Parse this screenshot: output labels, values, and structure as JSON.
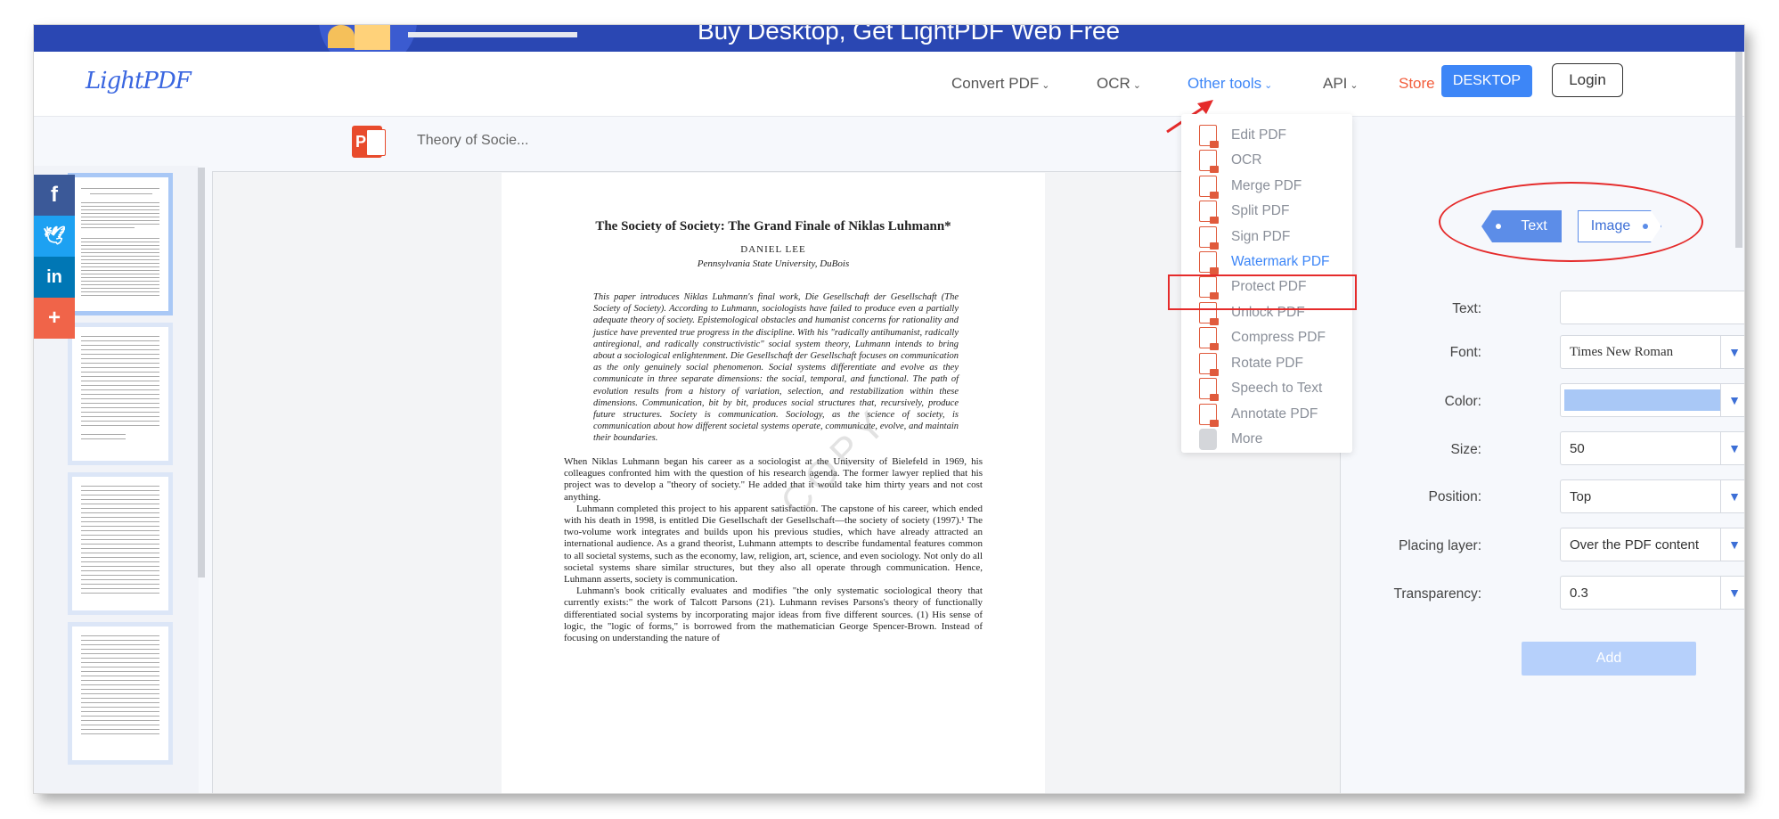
{
  "banner": {
    "text": "Buy Desktop, Get LightPDF Web Free"
  },
  "header": {
    "logo": "LightPDF",
    "nav": [
      "Convert PDF",
      "OCR",
      "Other tools",
      "API",
      "Store"
    ],
    "desktop_button": "DESKTOP",
    "login_button": "Login"
  },
  "file": {
    "icon_letter": "P",
    "name": "Theory of Socie..."
  },
  "social": [
    "facebook-icon",
    "twitter-icon",
    "linkedin-icon",
    "share-plus-icon"
  ],
  "dropdown": {
    "items": [
      "Edit PDF",
      "OCR",
      "Merge PDF",
      "Split PDF",
      "Sign PDF",
      "Watermark PDF",
      "Protect PDF",
      "Unlock PDF",
      "Compress PDF",
      "Rotate PDF",
      "Speech to Text",
      "Annotate PDF",
      "More"
    ],
    "highlighted": "Watermark PDF"
  },
  "document": {
    "title": "The Society of Society: The Grand Finale of Niklas Luhmann*",
    "author": "DANIEL LEE",
    "affiliation": "Pennsylvania State University, DuBois",
    "abstract": "This paper introduces Niklas Luhmann's final work, Die Gesellschaft der Gesellschaft (The Society of Society). According to Luhmann, sociologists have failed to produce even a partially adequate theory of society. Epistemological obstacles and humanist concerns for rationality and justice have prevented true progress in the discipline. With his \"radically antihumanist, radically antiregional, and radically constructivistic\" social system theory, Luhmann intends to bring about a sociological enlightenment. Die Gesellschaft der Gesellschaft focuses on communication as the only genuinely social phenomenon. Social systems differentiate and evolve as they communicate in three separate dimensions: the social, temporal, and functional. The path of evolution results from a history of variation, selection, and restabilization within these dimensions. Communication, bit by bit, produces social structures that, recursively, produce future structures. Society is communication. Sociology, as the science of society, is communication about how different societal systems operate, communicate, evolve, and maintain their boundaries.",
    "paragraphs": [
      "When Niklas Luhmann began his career as a sociologist at the University of Bielefeld in 1969, his colleagues confronted him with the question of his research agenda. The former lawyer replied that his project was to develop a \"theory of society.\" He added that it would take him thirty years and not cost anything.",
      "Luhmann completed this project to his apparent satisfaction. The capstone of his career, which ended with his death in 1998, is entitled Die Gesellschaft der Gesellschaft—the society of society (1997).¹ The two-volume work integrates and builds upon his previous studies, which have already attracted an international audience. As a grand theorist, Luhmann attempts to describe fundamental features common to all societal systems, such as the economy, law, religion, art, science, and even sociology. Not only do all societal systems share similar structures, but they also all operate through communication. Hence, Luhmann asserts, society is communication.",
      "Luhmann's book critically evaluates and modifies \"the only systematic sociological theory that currently exists:\" the work of Talcott Parsons (21). Luhmann revises Parsons's theory of functionally differentiated social systems by incorporating major ideas from five different sources. (1) His sense of logic, the \"logic of forms,\" is borrowed from the mathematician George Spencer-Brown. Instead of focusing on understanding the nature of"
    ],
    "watermark_text": "COPY"
  },
  "panel": {
    "tabs": {
      "text": "Text",
      "image": "Image"
    },
    "fields": {
      "text_label": "Text:",
      "text_value": "",
      "font_label": "Font:",
      "font_value": "Times New Roman",
      "color_label": "Color:",
      "color_value": "#a9c8f6",
      "size_label": "Size:",
      "size_value": "50",
      "position_label": "Position:",
      "position_value": "Top",
      "layer_label": "Placing layer:",
      "layer_value": "Over the PDF content",
      "transparency_label": "Transparency:",
      "transparency_value": "0.3"
    },
    "add_button": "Add"
  },
  "colors": {
    "accent": "#3d86f7",
    "store": "#f25d3c",
    "annotation_red": "#e52b2b"
  }
}
